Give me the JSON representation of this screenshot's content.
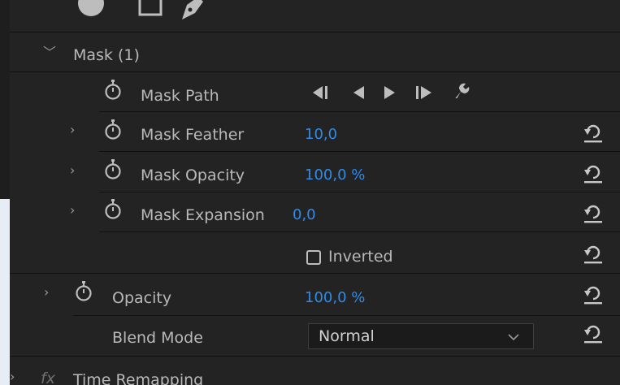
{
  "effect_controls": {
    "mask_header": {
      "label": "Mask (1)"
    },
    "mask_path": {
      "label": "Mask Path"
    },
    "mask_feather": {
      "label": "Mask Feather",
      "value": "10,0"
    },
    "mask_opacity": {
      "label": "Mask Opacity",
      "value": "100,0 %"
    },
    "mask_expansion": {
      "label": "Mask Expansion",
      "value": "0,0"
    },
    "inverted": {
      "label": "Inverted",
      "checked": false
    },
    "opacity": {
      "label": "Opacity",
      "value": "100,0 %"
    },
    "blend_mode": {
      "label": "Blend Mode",
      "value": "Normal"
    },
    "time_remapping": {
      "label": "Time Remapping",
      "fx_label": "fx"
    }
  },
  "icons": {
    "top_tools": [
      "ellipse-mask-icon",
      "rectangle-mask-icon",
      "pen-mask-icon"
    ],
    "mask_path_controls": [
      "track-backward-one-frame-icon",
      "track-backward-icon",
      "track-forward-icon",
      "track-forward-one-frame-icon",
      "wrench-icon"
    ],
    "reset": "reset-icon",
    "stopwatch": "stopwatch-icon"
  },
  "colors": {
    "value": "#2d8ceb",
    "text": "#b9b9b9",
    "background": "#232323"
  }
}
